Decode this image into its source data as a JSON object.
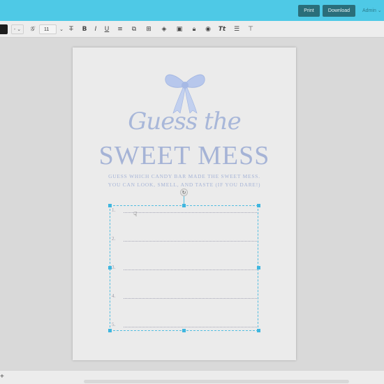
{
  "header": {
    "print_label": "Print",
    "download_label": "Download",
    "admin_label": "Admin ⌄"
  },
  "toolbar": {
    "font_dropdown": "- ⌄",
    "font_size": "11",
    "icons": [
      "font-icon",
      "strikethrough-icon",
      "bold-icon",
      "italic-icon",
      "underline-icon",
      "align-icon",
      "duplicate-icon",
      "add-icon",
      "layers-icon",
      "image-icon",
      "lock-icon",
      "color-icon",
      "text-style-icon",
      "line-height-icon",
      "clear-format-icon"
    ]
  },
  "page": {
    "script_title": "Guess the",
    "main_title": "SWEET MESS",
    "subtitle_line1": "GUESS WHICH CANDY BAR MADE THE SWEET MESS.",
    "subtitle_line2": "YOU CAN LOOK, SMELL, AND TASTE (IF YOU DARE!)",
    "guesses": [
      "1.",
      "2.",
      "3.",
      "4.",
      "5."
    ]
  },
  "bottom": {
    "add_label": "+"
  },
  "colors": {
    "header": "#4ec9e6",
    "button": "#2a6e7a",
    "title": "#a5b3d6",
    "selection": "#52bde0"
  }
}
